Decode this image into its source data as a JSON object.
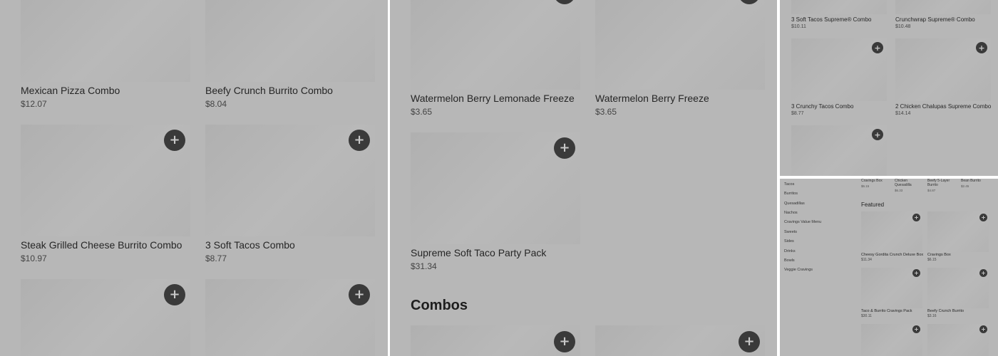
{
  "panel1": {
    "items": [
      {
        "name": "Mexican Pizza Combo",
        "price": "$12.07"
      },
      {
        "name": "Beefy Crunch Burrito Combo",
        "price": "$8.04"
      },
      {
        "name": "Steak Grilled Cheese Burrito Combo",
        "price": "$10.97"
      },
      {
        "name": "3 Soft Tacos Combo",
        "price": "$8.77"
      }
    ]
  },
  "panel2": {
    "items": [
      {
        "name": "Watermelon Berry Lemonade Freeze",
        "price": "$3.65"
      },
      {
        "name": "Watermelon Berry Freeze",
        "price": "$3.65"
      },
      {
        "name": "Supreme Soft Taco Party Pack",
        "price": "$31.34"
      }
    ],
    "section_heading": "Combos"
  },
  "panel3": {
    "items": [
      {
        "name": "3 Soft Tacos Supreme® Combo",
        "price": "$10.11"
      },
      {
        "name": "Crunchwrap Supreme® Combo",
        "price": "$10.48"
      },
      {
        "name": "3 Crunchy Tacos Combo",
        "price": "$8.77"
      },
      {
        "name": "2 Chicken Chalupas Supreme Combo",
        "price": "$14.14"
      }
    ]
  },
  "panel4": {
    "categories": [
      "Tacos",
      "Burritos",
      "Quesadillas",
      "Nachos",
      "Cravings Value Menu",
      "Sweets",
      "Sides",
      "Drinks",
      "Bowls",
      "Veggie Cravings"
    ],
    "top_items": [
      {
        "name": "Cravings Box",
        "price": "$6.15"
      },
      {
        "name": "Chicken Quesadilla",
        "price": "$6.33"
      },
      {
        "name": "Beefy 5-Layer Burrito",
        "price": "$4.87"
      },
      {
        "name": "Bean Burrito",
        "price": "$2.45"
      }
    ],
    "featured_heading": "Featured",
    "featured_items": [
      {
        "name": "Cheesy Gordita Crunch Deluxe Box",
        "price": "$11.34"
      },
      {
        "name": "Cravings Box",
        "price": "$6.15"
      },
      {
        "name": "Taco & Burrito Cravings Pack",
        "price": "$30.11"
      },
      {
        "name": "Beefy Crunch Burrito",
        "price": "$3.16"
      }
    ]
  },
  "icons": {
    "add": "plus-icon"
  },
  "colors": {
    "overlay": "#b7b7b7",
    "add_button": "#3a3a3a",
    "divider": "#ffffff"
  }
}
